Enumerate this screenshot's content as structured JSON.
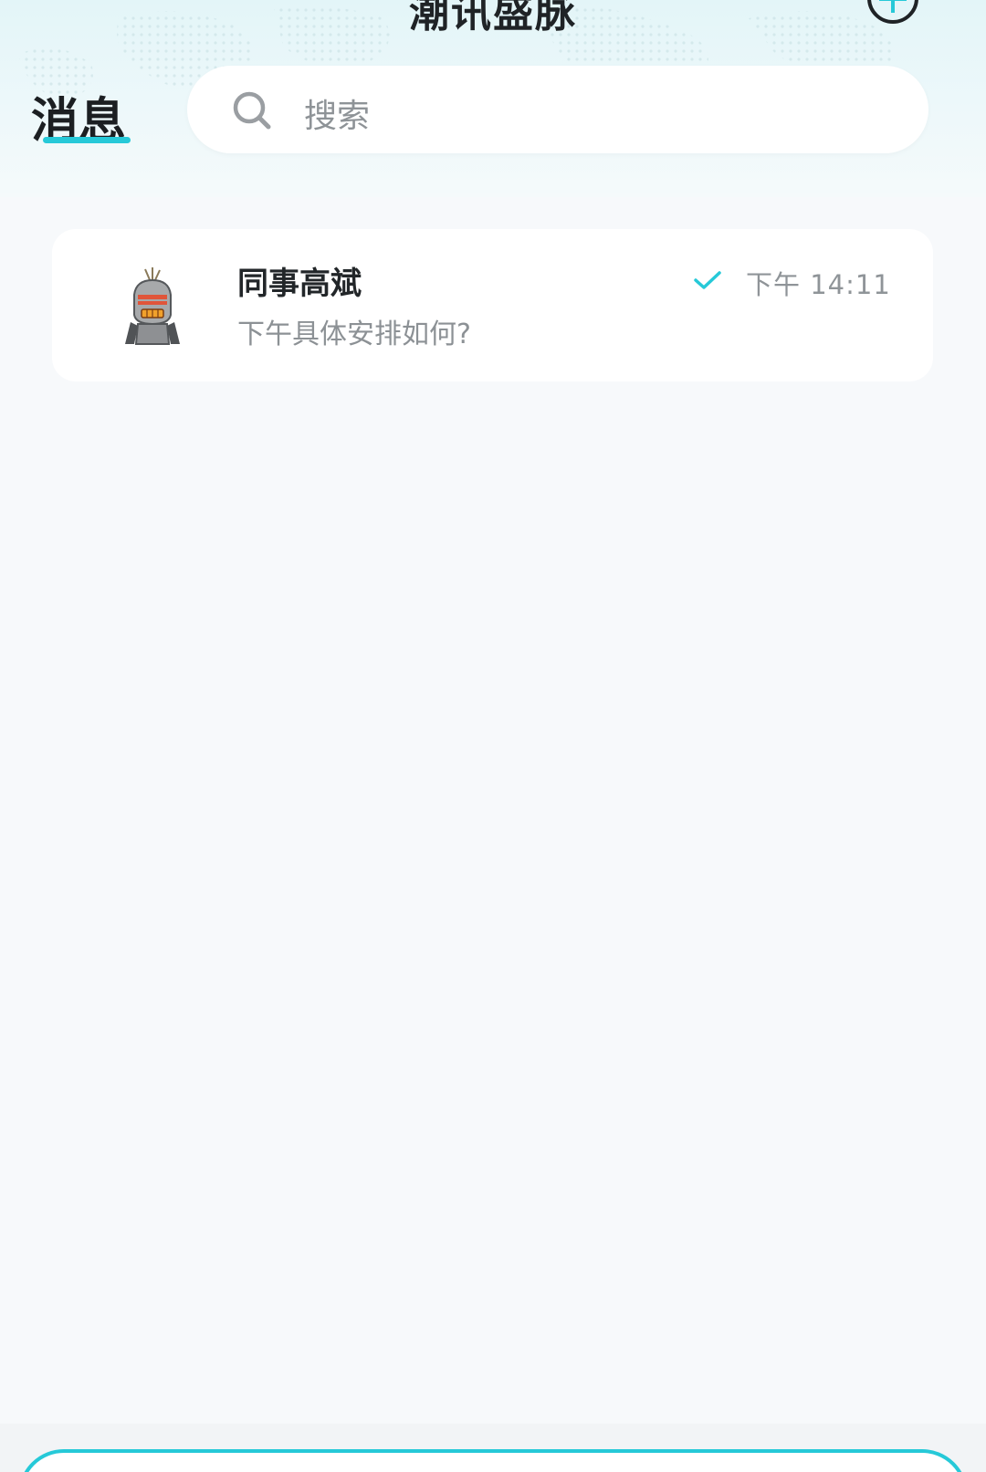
{
  "header": {
    "app_title": "潮讯盛脉",
    "active_tab": "消息"
  },
  "search": {
    "placeholder": "搜索"
  },
  "chats": [
    {
      "name": "同事高斌",
      "last_message": "下午具体安排如何?",
      "time": "下午 14:11",
      "status": "read"
    }
  ],
  "colors": {
    "accent": "#26c9d8",
    "background": "#f7f9fb",
    "card": "#ffffff"
  },
  "icons": {
    "add": "plus-circle-icon",
    "search": "search-icon",
    "read": "check-icon"
  }
}
